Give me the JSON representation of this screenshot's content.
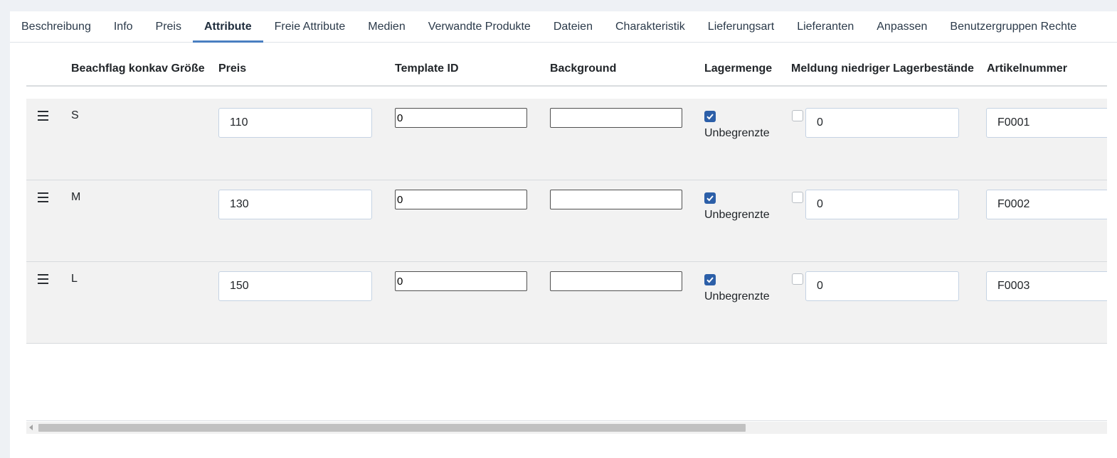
{
  "tabs": [
    {
      "label": "Beschreibung",
      "active": false
    },
    {
      "label": "Info",
      "active": false
    },
    {
      "label": "Preis",
      "active": false
    },
    {
      "label": "Attribute",
      "active": true
    },
    {
      "label": "Freie Attribute",
      "active": false
    },
    {
      "label": "Medien",
      "active": false
    },
    {
      "label": "Verwandte Produkte",
      "active": false
    },
    {
      "label": "Dateien",
      "active": false
    },
    {
      "label": "Charakteristik",
      "active": false
    },
    {
      "label": "Lieferungsart",
      "active": false
    },
    {
      "label": "Lieferanten",
      "active": false
    },
    {
      "label": "Anpassen",
      "active": false
    },
    {
      "label": "Benutzergruppen Rechte",
      "active": false
    }
  ],
  "table": {
    "columns": {
      "size": "Beachflag konkav Größe",
      "price": "Preis",
      "template_id": "Template ID",
      "background": "Background",
      "stock": "Lagermenge",
      "low_stock": "Meldung niedriger Lagerbestände",
      "sku": "Artikelnummer"
    },
    "unlimited_label": "Unbegrenzte",
    "rows": [
      {
        "size": "S",
        "price": "110",
        "template_id": "0",
        "background": "",
        "unlimited": true,
        "low_stock_enabled": false,
        "low_stock": "0",
        "sku": "F0001"
      },
      {
        "size": "M",
        "price": "130",
        "template_id": "0",
        "background": "",
        "unlimited": true,
        "low_stock_enabled": false,
        "low_stock": "0",
        "sku": "F0002"
      },
      {
        "size": "L",
        "price": "150",
        "template_id": "0",
        "background": "",
        "unlimited": true,
        "low_stock_enabled": false,
        "low_stock": "0",
        "sku": "F0003"
      }
    ]
  },
  "colors": {
    "accent": "#4a7fc1",
    "checkbox": "#2c5fa8",
    "row_bg": "#f2f2f2"
  },
  "icons": {
    "drag_handle": "drag-handle-icon",
    "check": "checkmark-icon"
  }
}
